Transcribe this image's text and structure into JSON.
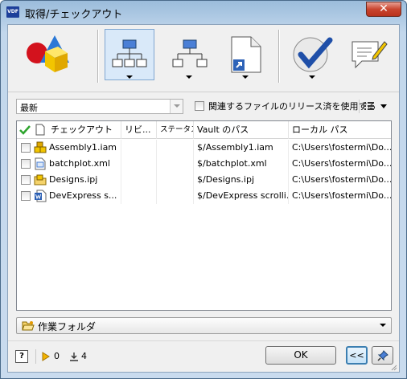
{
  "window": {
    "title": "取得/チェックアウト",
    "icon_text": "VDF",
    "close_glyph": "✕"
  },
  "toolbar": {
    "buttons": [
      {
        "name": "settings-shapes-icon"
      },
      {
        "name": "include-children-icon",
        "selected": true
      },
      {
        "name": "include-parents-icon"
      },
      {
        "name": "include-related-docs-icon"
      },
      {
        "name": "checkout-check-icon"
      },
      {
        "name": "comment-icon"
      }
    ]
  },
  "filter": {
    "version_select": "最新",
    "use_released_label": "関連するファイルのリリース済を使用する"
  },
  "table": {
    "headers": {
      "checkout": "チェックアウト",
      "revision": "リビ...",
      "status": "ステータス",
      "vault_path": "Vault のパス",
      "local_path": "ローカル パス"
    },
    "rows": [
      {
        "name": "Assembly1.iam",
        "vault": "$/Assembly1.iam",
        "local": "C:\\Users\\fostermi\\Do...",
        "icon": "assembly-icon"
      },
      {
        "name": "batchplot.xml",
        "vault": "$/batchplot.xml",
        "local": "C:\\Users\\fostermi\\Do...",
        "icon": "xml-file-icon"
      },
      {
        "name": "Designs.ipj",
        "vault": "$/Designs.ipj",
        "local": "C:\\Users\\fostermi\\Do...",
        "icon": "project-file-icon"
      },
      {
        "name": "DevExpress s...",
        "vault": "$/DevExpress scrolli...",
        "local": "C:\\Users\\fostermi\\Do...",
        "icon": "word-doc-icon"
      }
    ]
  },
  "folder": {
    "label": "作業フォルダ"
  },
  "status": {
    "help_label": "?",
    "count_a": "0",
    "count_b": "4"
  },
  "buttons": {
    "ok": "OK",
    "less": "<<"
  },
  "colors": {
    "accent": "#3c7fb1",
    "check_green": "#2fa52f",
    "close_red": "#c9452f"
  }
}
